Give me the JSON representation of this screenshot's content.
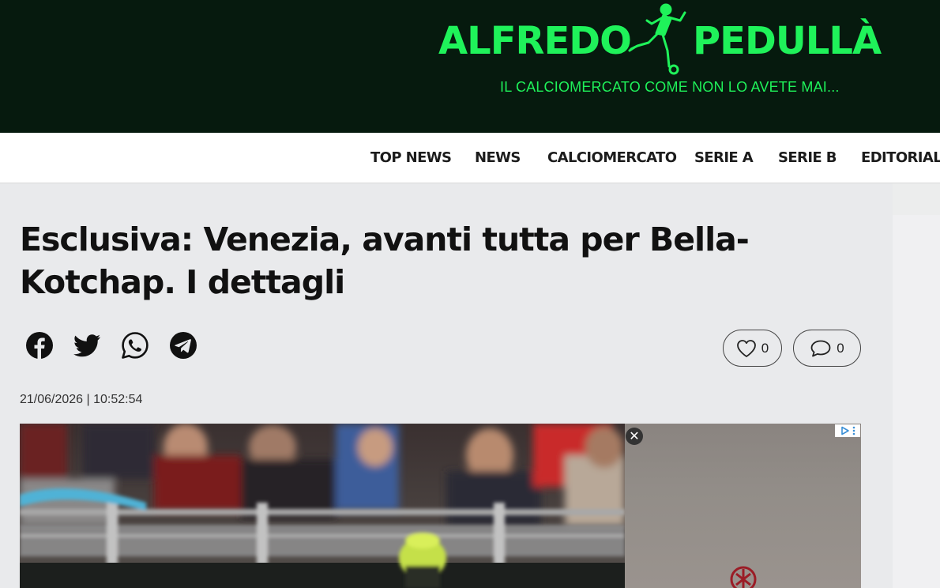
{
  "brand": {
    "name_left": "ALFREDO",
    "name_right": "PEDULLÀ",
    "tagline": "IL CALCIOMERCATO COME NON LO AVETE MAI...",
    "accent_color": "#1ff25a",
    "header_bg": "#061a0e"
  },
  "nav": {
    "items": [
      {
        "label": "TOP NEWS"
      },
      {
        "label": "NEWS"
      },
      {
        "label": "CALCIOMERCATO"
      },
      {
        "label": "SERIE A"
      },
      {
        "label": "SERIE B"
      },
      {
        "label": "EDITORIALE"
      }
    ]
  },
  "article": {
    "title": "Esclusiva: Venezia, avanti tutta per Bella-Kotchap. I dettagli",
    "date": "21/06/2026 | 10:52:54",
    "likes": "0",
    "comments": "0"
  },
  "share": {
    "icons": [
      "facebook-icon",
      "twitter-icon",
      "whatsapp-icon",
      "telegram-icon"
    ]
  },
  "ad": {
    "close_icon": "close-icon",
    "choices_icon": "ad-choices-icon"
  }
}
